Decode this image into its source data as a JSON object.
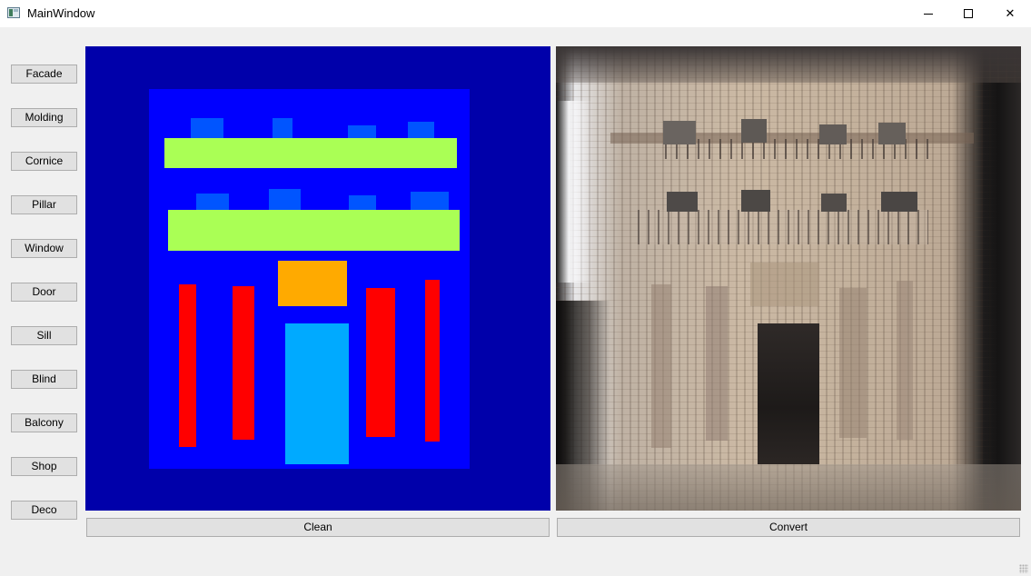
{
  "window": {
    "title": "MainWindow",
    "controls": [
      "minimize-icon",
      "maximize-icon",
      "close-icon"
    ]
  },
  "sidebar": {
    "items": [
      {
        "label": "Facade"
      },
      {
        "label": "Molding"
      },
      {
        "label": "Cornice"
      },
      {
        "label": "Pillar"
      },
      {
        "label": "Window"
      },
      {
        "label": "Door"
      },
      {
        "label": "Sill"
      },
      {
        "label": "Blind"
      },
      {
        "label": "Balcony"
      },
      {
        "label": "Shop"
      },
      {
        "label": "Deco"
      }
    ]
  },
  "label_map": {
    "background_color": "#0000aa",
    "facade_color": "#0000ff",
    "window_color": "#0055ff",
    "sill_color": "#aaff55",
    "pillar_color": "#ff0000",
    "deco_color": "#ffaa00",
    "door_color": "#00aaff"
  },
  "buttons": {
    "clean_label": "Clean",
    "convert_label": "Convert"
  }
}
